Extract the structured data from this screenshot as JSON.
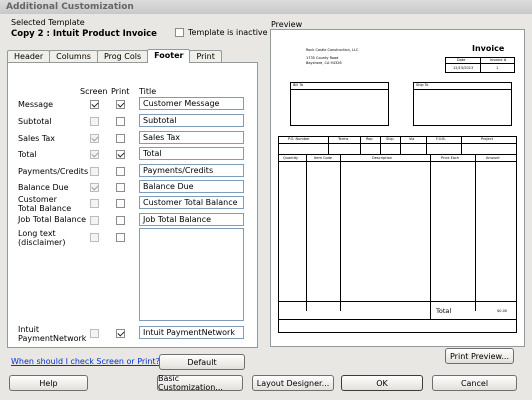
{
  "window": {
    "title": "Additional Customization"
  },
  "template": {
    "label": "Selected Template",
    "name": "Copy 2 : Intuit Product Invoice",
    "inactive_label": "Template is inactive",
    "inactive_checked": false
  },
  "tabs": [
    {
      "label": "Header",
      "active": false
    },
    {
      "label": "Columns",
      "active": false
    },
    {
      "label": "Prog Cols",
      "active": false
    },
    {
      "label": "Footer",
      "active": true
    },
    {
      "label": "Print",
      "active": false
    }
  ],
  "columns": {
    "screen": "Screen",
    "print": "Print",
    "title": "Title"
  },
  "rows": [
    {
      "label": "Message",
      "screen": true,
      "screen_disabled": false,
      "print": true,
      "print_disabled": false,
      "title": "Customer Message"
    },
    {
      "label": "Subtotal",
      "screen": false,
      "screen_disabled": true,
      "print": false,
      "print_disabled": false,
      "title": "Subtotal"
    },
    {
      "label": "Sales Tax",
      "screen": true,
      "screen_disabled": true,
      "print": false,
      "print_disabled": false,
      "title": "Sales Tax"
    },
    {
      "label": "Total",
      "screen": true,
      "screen_disabled": true,
      "print": true,
      "print_disabled": false,
      "title": "Total"
    },
    {
      "label": "Payments/Credits",
      "screen": false,
      "screen_disabled": true,
      "print": false,
      "print_disabled": false,
      "title": "Payments/Credits"
    },
    {
      "label": "Balance Due",
      "screen": true,
      "screen_disabled": true,
      "print": false,
      "print_disabled": false,
      "title": "Balance Due"
    },
    {
      "label": "Customer Total Balance",
      "screen": false,
      "screen_disabled": true,
      "print": false,
      "print_disabled": false,
      "title": "Customer Total Balance"
    },
    {
      "label": "Job Total Balance",
      "screen": false,
      "screen_disabled": true,
      "print": false,
      "print_disabled": false,
      "title": "Job Total Balance"
    },
    {
      "label": "Long text (disclaimer)",
      "screen": false,
      "screen_disabled": true,
      "print": false,
      "print_disabled": false,
      "title": ""
    },
    {
      "label": "Intuit PaymentNetwork",
      "screen": false,
      "screen_disabled": true,
      "print": true,
      "print_disabled": false,
      "title": "Intuit PaymentNetwork"
    }
  ],
  "help_link": "When should I check Screen or Print?",
  "buttons": {
    "default": "Default",
    "print_preview": "Print Preview...",
    "help": "Help",
    "basic": "Basic Customization...",
    "layout": "Layout Designer...",
    "ok": "OK",
    "cancel": "Cancel"
  },
  "preview": {
    "label": "Preview",
    "company_name": "Rock Castle Construction, LLC",
    "company_addr1": "1735 County Road",
    "company_addr2": "Bayshore, CA 94326",
    "doc_title": "Invoice",
    "date_hdr": "Date",
    "invoice_hdr": "Invoice #",
    "date_val": "12/15/2013",
    "invoice_val": "1",
    "bill_to": "Bill To",
    "ship_to": "Ship To",
    "fields": [
      "P.O. Number",
      "Terms",
      "Rep",
      "Ship",
      "Via",
      "F.O.B.",
      "Project"
    ],
    "line_cols": [
      "Quantity",
      "Item Code",
      "Description",
      "Price Each",
      "Amount"
    ],
    "total_label": "Total",
    "total_val": "$0.00"
  }
}
